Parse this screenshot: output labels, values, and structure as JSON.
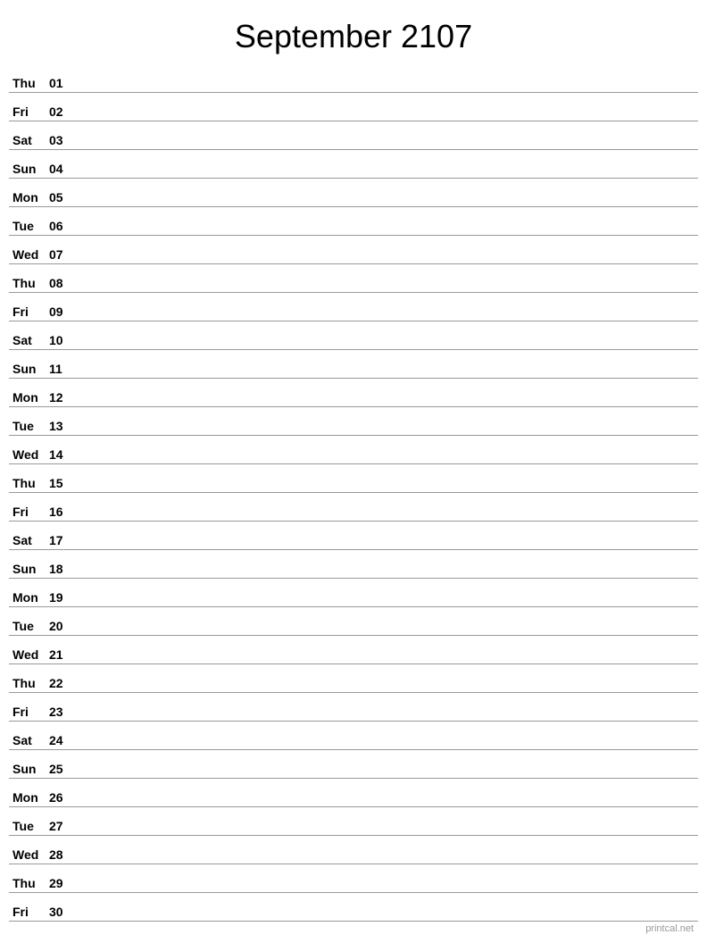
{
  "header": {
    "title": "September 2107"
  },
  "days": [
    {
      "name": "Thu",
      "number": "01"
    },
    {
      "name": "Fri",
      "number": "02"
    },
    {
      "name": "Sat",
      "number": "03"
    },
    {
      "name": "Sun",
      "number": "04"
    },
    {
      "name": "Mon",
      "number": "05"
    },
    {
      "name": "Tue",
      "number": "06"
    },
    {
      "name": "Wed",
      "number": "07"
    },
    {
      "name": "Thu",
      "number": "08"
    },
    {
      "name": "Fri",
      "number": "09"
    },
    {
      "name": "Sat",
      "number": "10"
    },
    {
      "name": "Sun",
      "number": "11"
    },
    {
      "name": "Mon",
      "number": "12"
    },
    {
      "name": "Tue",
      "number": "13"
    },
    {
      "name": "Wed",
      "number": "14"
    },
    {
      "name": "Thu",
      "number": "15"
    },
    {
      "name": "Fri",
      "number": "16"
    },
    {
      "name": "Sat",
      "number": "17"
    },
    {
      "name": "Sun",
      "number": "18"
    },
    {
      "name": "Mon",
      "number": "19"
    },
    {
      "name": "Tue",
      "number": "20"
    },
    {
      "name": "Wed",
      "number": "21"
    },
    {
      "name": "Thu",
      "number": "22"
    },
    {
      "name": "Fri",
      "number": "23"
    },
    {
      "name": "Sat",
      "number": "24"
    },
    {
      "name": "Sun",
      "number": "25"
    },
    {
      "name": "Mon",
      "number": "26"
    },
    {
      "name": "Tue",
      "number": "27"
    },
    {
      "name": "Wed",
      "number": "28"
    },
    {
      "name": "Thu",
      "number": "29"
    },
    {
      "name": "Fri",
      "number": "30"
    }
  ],
  "watermark": "printcal.net"
}
